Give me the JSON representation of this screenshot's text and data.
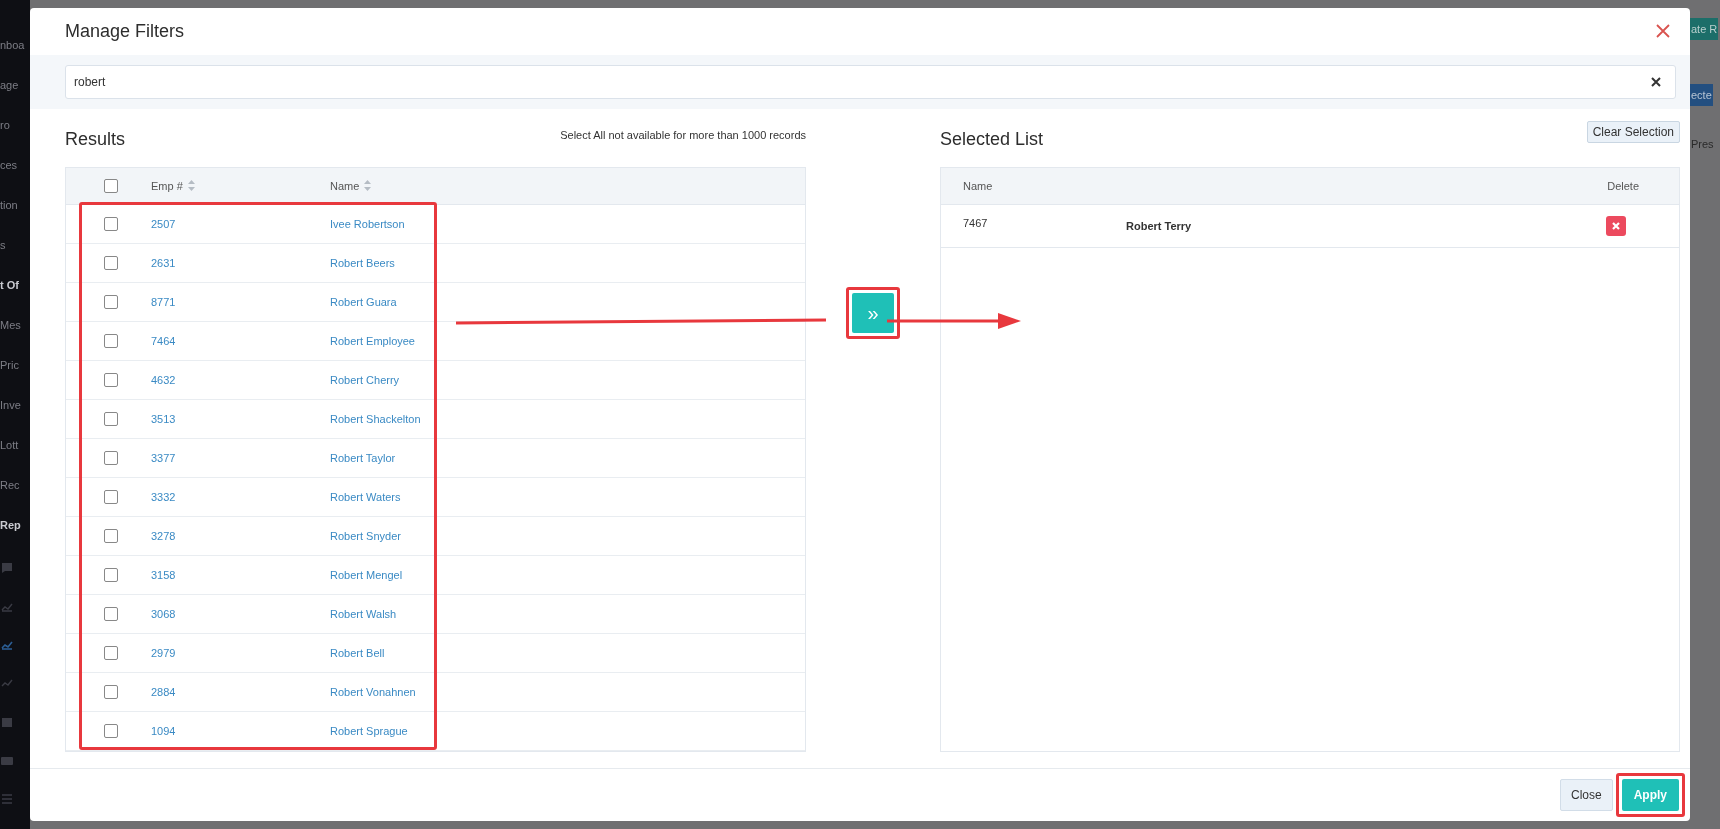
{
  "background": {
    "sidebar_items": [
      {
        "label": "nboa",
        "kind": "link"
      },
      {
        "label": "age",
        "kind": "link"
      },
      {
        "label": "ro",
        "kind": "link"
      },
      {
        "label": "ces",
        "kind": "link"
      },
      {
        "label": "tion",
        "kind": "link"
      },
      {
        "label": "s",
        "kind": "link"
      },
      {
        "label": "t Of",
        "kind": "section"
      },
      {
        "label": "Mes",
        "kind": "link"
      },
      {
        "label": "Pric",
        "kind": "link"
      },
      {
        "label": "Inve",
        "kind": "link"
      },
      {
        "label": "Lott",
        "kind": "link"
      },
      {
        "label": "Rec",
        "kind": "link"
      },
      {
        "label": "Rep",
        "kind": "section"
      }
    ],
    "right_items": [
      {
        "label": "ate R",
        "kind": "teal-button"
      },
      {
        "label": "ecte",
        "kind": "blue-button"
      },
      {
        "label": "Pres",
        "kind": "text"
      }
    ]
  },
  "dialog": {
    "title": "Manage Filters",
    "search": {
      "value": "robert"
    },
    "results": {
      "title": "Results",
      "note": "Select All not available for more than 1000 records",
      "columns": [
        "Emp #",
        "Name"
      ],
      "select_all_checked": false,
      "rows": [
        {
          "emp": "2507",
          "name": "Ivee Robertson",
          "checked": false
        },
        {
          "emp": "2631",
          "name": "Robert Beers",
          "checked": false
        },
        {
          "emp": "8771",
          "name": "Robert Guara",
          "checked": false
        },
        {
          "emp": "7464",
          "name": "Robert Employee",
          "checked": false
        },
        {
          "emp": "4632",
          "name": "Robert Cherry",
          "checked": false
        },
        {
          "emp": "3513",
          "name": "Robert Shackelton",
          "checked": false
        },
        {
          "emp": "3377",
          "name": "Robert Taylor",
          "checked": false
        },
        {
          "emp": "3332",
          "name": "Robert Waters",
          "checked": false
        },
        {
          "emp": "3278",
          "name": "Robert Snyder",
          "checked": false
        },
        {
          "emp": "3158",
          "name": "Robert Mengel",
          "checked": false
        },
        {
          "emp": "3068",
          "name": "Robert Walsh",
          "checked": false
        },
        {
          "emp": "2979",
          "name": "Robert Bell",
          "checked": false
        },
        {
          "emp": "2884",
          "name": "Robert Vonahnen",
          "checked": false
        },
        {
          "emp": "1094",
          "name": "Robert Sprague",
          "checked": false
        }
      ]
    },
    "transfer_label": "»",
    "selected_list": {
      "title": "Selected List",
      "clear_label": "Clear Selection",
      "columns": [
        "Name",
        "Delete"
      ],
      "rows": [
        {
          "emp": "7467",
          "name": "Robert Terry"
        }
      ]
    },
    "buttons": [
      {
        "label": "Close",
        "kind": "secondary"
      },
      {
        "label": "Apply",
        "kind": "primary"
      }
    ]
  }
}
